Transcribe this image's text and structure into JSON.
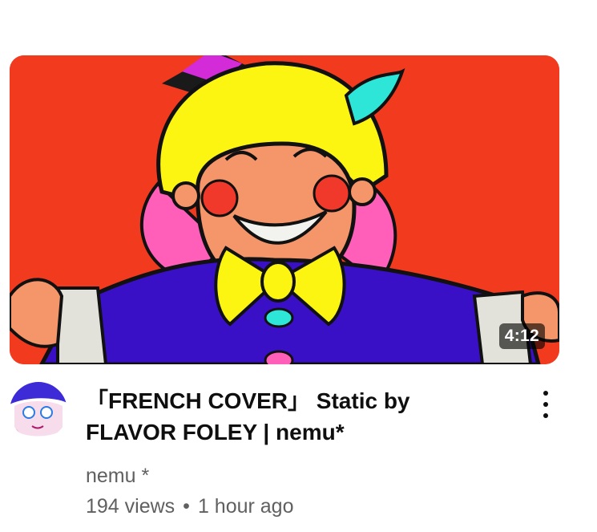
{
  "video": {
    "title_line1": "「FRENCH COVER」 Static by",
    "title_line2": "FLAVOR FOLEY | nemu*",
    "duration": "4:12",
    "channel": "nemu *",
    "views": "194 views",
    "separator": "•",
    "age": "1 hour ago"
  },
  "icons": {
    "more": "more-vert-icon"
  },
  "colors": {
    "thumbnail_bg": "#f23a1f",
    "title_text": "#0f0f0f",
    "secondary_text": "#606060"
  }
}
